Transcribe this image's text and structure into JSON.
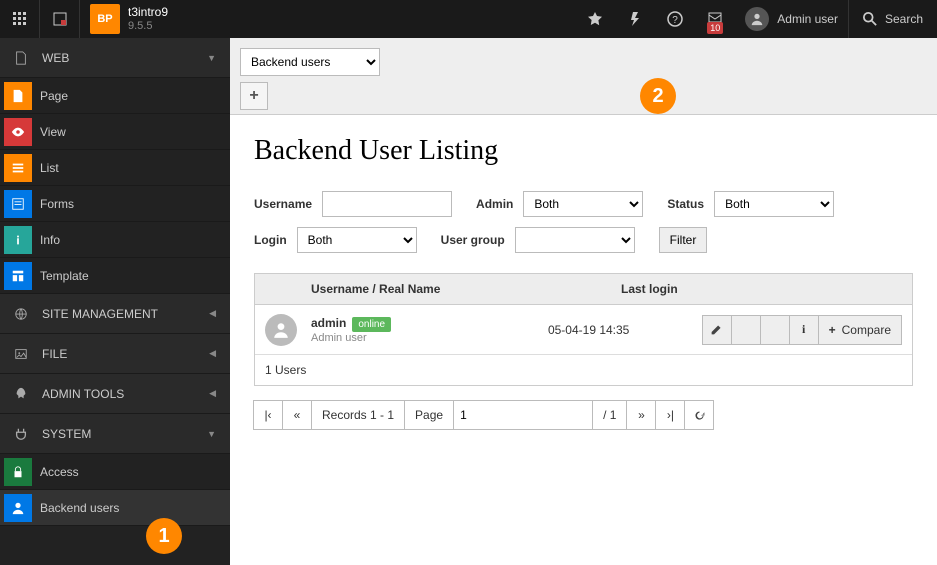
{
  "topbar": {
    "site_name": "t3intro9",
    "version": "9.5.5",
    "logo_text": "BP",
    "user_label": "Admin user",
    "search_placeholder": "Search",
    "notif_count": "10"
  },
  "sidebar": {
    "web": {
      "label": "WEB"
    },
    "web_items": [
      {
        "label": "Page"
      },
      {
        "label": "View"
      },
      {
        "label": "List"
      },
      {
        "label": "Forms"
      },
      {
        "label": "Info"
      },
      {
        "label": "Template"
      }
    ],
    "site_mgmt": {
      "label": "SITE MANAGEMENT"
    },
    "file": {
      "label": "FILE"
    },
    "admin_tools": {
      "label": "ADMIN TOOLS"
    },
    "system": {
      "label": "SYSTEM"
    },
    "system_items": [
      {
        "label": "Access"
      },
      {
        "label": "Backend users"
      }
    ]
  },
  "toolbar": {
    "select_value": "Backend users",
    "add_label": "+"
  },
  "page": {
    "title": "Backend User Listing",
    "filters": {
      "username_label": "Username",
      "admin_label": "Admin",
      "admin_value": "Both",
      "status_label": "Status",
      "status_value": "Both",
      "login_label": "Login",
      "login_value": "Both",
      "usergroup_label": "User group",
      "filter_button": "Filter"
    },
    "table": {
      "th_username": "Username / Real Name",
      "th_lastlogin": "Last login",
      "rows": [
        {
          "username": "admin",
          "status": "online",
          "realname": "Admin user",
          "last_login": "05-04-19 14:35",
          "compare_label": "Compare"
        }
      ],
      "footer": "1 Users"
    },
    "pager": {
      "records": "Records 1 - 1",
      "page_label": "Page",
      "page_value": "1",
      "page_total": "/ 1"
    }
  },
  "callouts": {
    "one": "1",
    "two": "2"
  }
}
